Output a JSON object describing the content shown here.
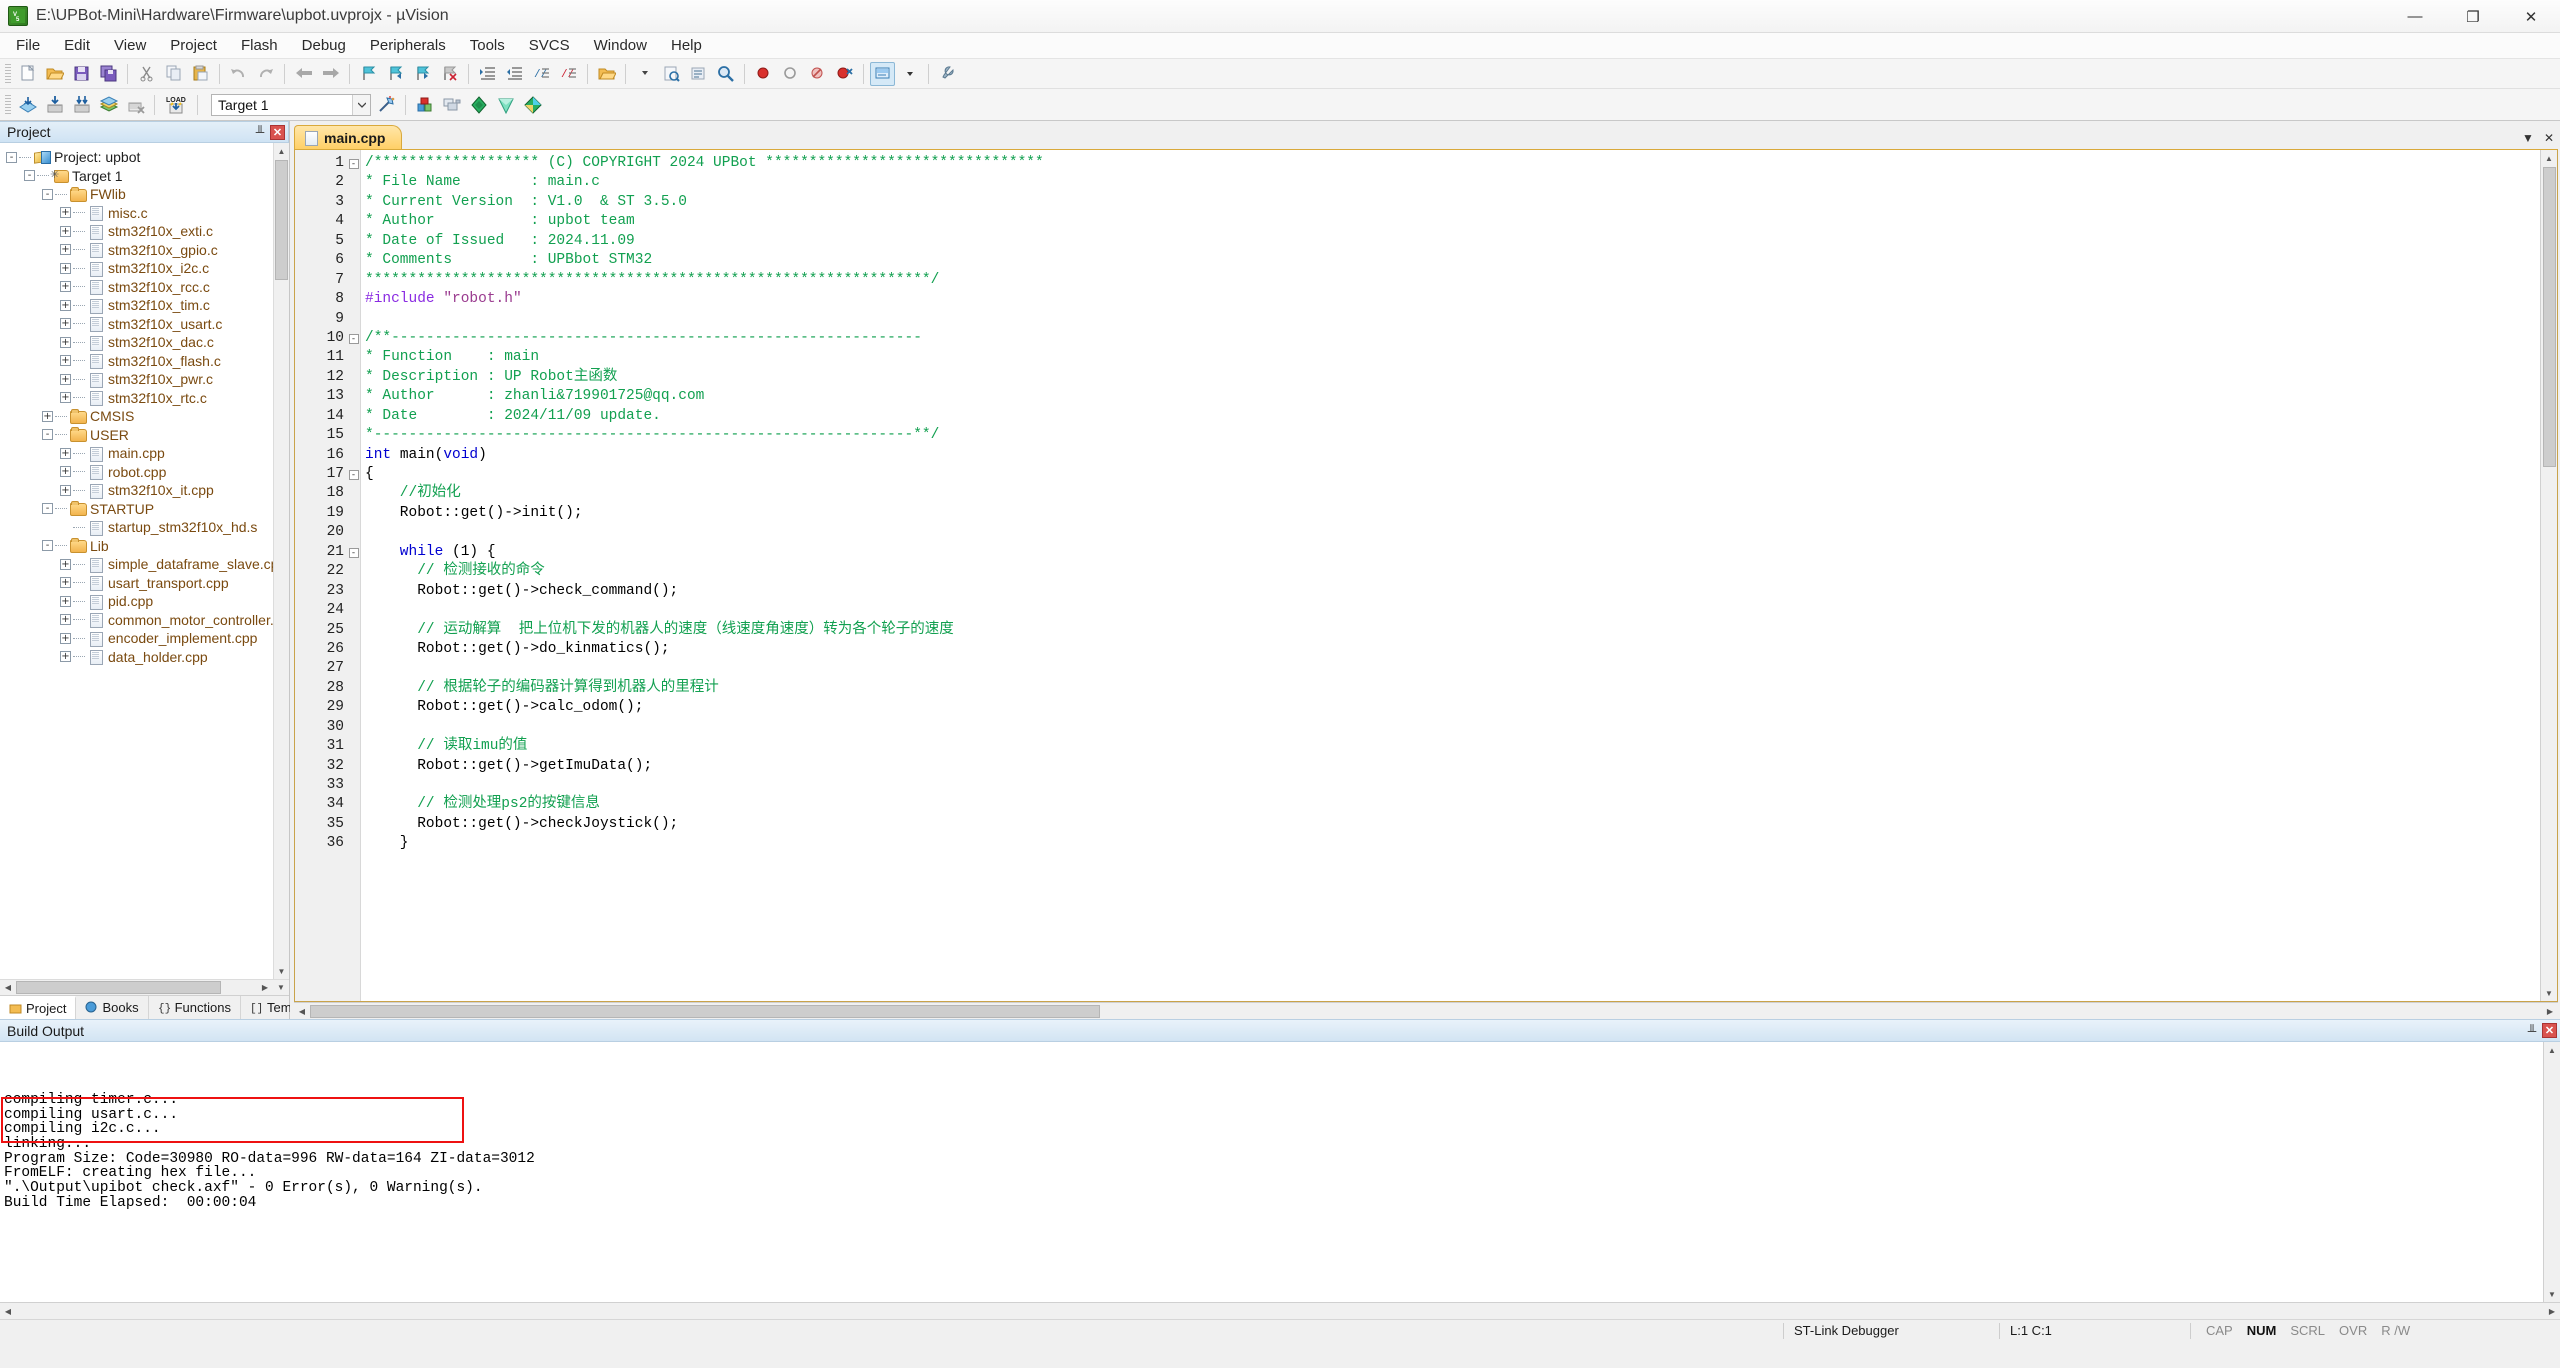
{
  "window": {
    "title": "E:\\UPBot-Mini\\Hardware\\Firmware\\upbot.uvprojx - µVision",
    "app_icon": "uvision-icon",
    "minimize": "—",
    "maximize": "❐",
    "close": "✕"
  },
  "menu": [
    "File",
    "Edit",
    "View",
    "Project",
    "Flash",
    "Debug",
    "Peripherals",
    "Tools",
    "SVCS",
    "Window",
    "Help"
  ],
  "toolbar_main": [
    "new-file-icon",
    "open-file-icon",
    "save-icon",
    "save-all-icon",
    "cut-icon",
    "copy-icon",
    "paste-icon",
    "undo-icon",
    "redo-icon",
    "navigate-back-icon",
    "navigate-forward-icon",
    "bookmark-toggle-icon",
    "bookmark-prev-icon",
    "bookmark-next-icon",
    "bookmark-clear-icon",
    "indent-icon",
    "outdent-icon",
    "comment-icon",
    "uncomment-icon",
    "open-folder-icon",
    "incremental-find-dropdown-icon",
    "find-in-files-icon",
    "browse-icon",
    "find-icon",
    "insert-breakpoint-icon",
    "remove-breakpoint-icon",
    "disable-breakpoint-icon",
    "kill-breakpoints-icon",
    "debug-session-icon",
    "configure-icon"
  ],
  "toolbar_build": [
    "translate-icon",
    "build-icon",
    "rebuild-icon",
    "batch-build-icon",
    "stop-build-icon",
    "download-icon"
  ],
  "target": {
    "selected": "Target 1",
    "dropdown_arrow": "chevron-down-icon",
    "buttons": [
      "target-options-icon",
      "manage-project-items-icon",
      "manage-run-time-env-icon",
      "pack-installer-icon",
      "manage-multi-project-icon",
      "select-software-packs-icon"
    ]
  },
  "project_panel": {
    "title": "Project",
    "pin_icon": "pin-icon",
    "close_icon": "close-icon",
    "tree": [
      {
        "label": "Project: upbot",
        "indent": 0,
        "toggle": "-",
        "icon": "proj"
      },
      {
        "label": "Target 1",
        "indent": 1,
        "toggle": "-",
        "icon": "target"
      },
      {
        "label": "FWlib",
        "indent": 2,
        "toggle": "-",
        "icon": "folder"
      },
      {
        "label": "misc.c",
        "indent": 3,
        "toggle": "+",
        "icon": "file"
      },
      {
        "label": "stm32f10x_exti.c",
        "indent": 3,
        "toggle": "+",
        "icon": "file"
      },
      {
        "label": "stm32f10x_gpio.c",
        "indent": 3,
        "toggle": "+",
        "icon": "file"
      },
      {
        "label": "stm32f10x_i2c.c",
        "indent": 3,
        "toggle": "+",
        "icon": "file"
      },
      {
        "label": "stm32f10x_rcc.c",
        "indent": 3,
        "toggle": "+",
        "icon": "file"
      },
      {
        "label": "stm32f10x_tim.c",
        "indent": 3,
        "toggle": "+",
        "icon": "file"
      },
      {
        "label": "stm32f10x_usart.c",
        "indent": 3,
        "toggle": "+",
        "icon": "file"
      },
      {
        "label": "stm32f10x_dac.c",
        "indent": 3,
        "toggle": "+",
        "icon": "file"
      },
      {
        "label": "stm32f10x_flash.c",
        "indent": 3,
        "toggle": "+",
        "icon": "file"
      },
      {
        "label": "stm32f10x_pwr.c",
        "indent": 3,
        "toggle": "+",
        "icon": "file"
      },
      {
        "label": "stm32f10x_rtc.c",
        "indent": 3,
        "toggle": "+",
        "icon": "file"
      },
      {
        "label": "CMSIS",
        "indent": 2,
        "toggle": "+",
        "icon": "folder"
      },
      {
        "label": "USER",
        "indent": 2,
        "toggle": "-",
        "icon": "folder"
      },
      {
        "label": "main.cpp",
        "indent": 3,
        "toggle": "+",
        "icon": "file"
      },
      {
        "label": "robot.cpp",
        "indent": 3,
        "toggle": "+",
        "icon": "file"
      },
      {
        "label": "stm32f10x_it.cpp",
        "indent": 3,
        "toggle": "+",
        "icon": "file"
      },
      {
        "label": "STARTUP",
        "indent": 2,
        "toggle": "-",
        "icon": "folder"
      },
      {
        "label": "startup_stm32f10x_hd.s",
        "indent": 3,
        "toggle": "",
        "icon": "file"
      },
      {
        "label": "Lib",
        "indent": 2,
        "toggle": "-",
        "icon": "folder"
      },
      {
        "label": "simple_dataframe_slave.cpp",
        "indent": 3,
        "toggle": "+",
        "icon": "file"
      },
      {
        "label": "usart_transport.cpp",
        "indent": 3,
        "toggle": "+",
        "icon": "file"
      },
      {
        "label": "pid.cpp",
        "indent": 3,
        "toggle": "+",
        "icon": "file"
      },
      {
        "label": "common_motor_controller.cpp",
        "indent": 3,
        "toggle": "+",
        "icon": "file"
      },
      {
        "label": "encoder_implement.cpp",
        "indent": 3,
        "toggle": "+",
        "icon": "file"
      },
      {
        "label": "data_holder.cpp",
        "indent": 3,
        "toggle": "+",
        "icon": "file"
      }
    ],
    "tabs": [
      {
        "label": "Project",
        "icon": "project-icon",
        "active": true
      },
      {
        "label": "Books",
        "icon": "books-icon",
        "active": false
      },
      {
        "label": "Functions",
        "icon": "functions-icon",
        "active": false
      },
      {
        "label": "Templates",
        "icon": "templates-icon",
        "active": false
      }
    ]
  },
  "editor": {
    "tab": {
      "label": "main.cpp",
      "icon": "file-icon"
    },
    "restore_icon": "chevron-down-icon",
    "close_icon": "close-icon",
    "lines": [
      {
        "n": 1,
        "fold": "-",
        "tokens": [
          {
            "t": "/******************* ",
            "c": "cmt"
          },
          {
            "t": "(C) COPYRIGHT 2024 UPBot ********************************",
            "c": "cmt"
          }
        ]
      },
      {
        "n": 2,
        "fold": "",
        "tokens": [
          {
            "t": "* File Name        : main.c",
            "c": "cmt"
          }
        ]
      },
      {
        "n": 3,
        "fold": "",
        "tokens": [
          {
            "t": "* Current Version  : V1.0  & ST 3.5.0",
            "c": "cmt"
          }
        ]
      },
      {
        "n": 4,
        "fold": "",
        "tokens": [
          {
            "t": "* Author           : upbot team",
            "c": "cmt"
          }
        ]
      },
      {
        "n": 5,
        "fold": "",
        "tokens": [
          {
            "t": "* Date of Issued   : 2024.11.09",
            "c": "cmt"
          }
        ]
      },
      {
        "n": 6,
        "fold": "",
        "tokens": [
          {
            "t": "* Comments         : UPBbot STM32",
            "c": "cmt"
          }
        ]
      },
      {
        "n": 7,
        "fold": "",
        "tokens": [
          {
            "t": "*****************************************************************/",
            "c": "cmt"
          }
        ]
      },
      {
        "n": 8,
        "fold": "",
        "tokens": [
          {
            "t": "#include ",
            "c": "pre"
          },
          {
            "t": "\"robot.h\"",
            "c": "str"
          }
        ]
      },
      {
        "n": 9,
        "fold": "",
        "tokens": []
      },
      {
        "n": 10,
        "fold": "-",
        "tokens": [
          {
            "t": "/**-------------------------------------------------------------",
            "c": "cmt"
          }
        ]
      },
      {
        "n": 11,
        "fold": "",
        "tokens": [
          {
            "t": "* Function    : main",
            "c": "cmt"
          }
        ]
      },
      {
        "n": 12,
        "fold": "",
        "tokens": [
          {
            "t": "* Description : UP Robot主函数",
            "c": "cmt"
          }
        ]
      },
      {
        "n": 13,
        "fold": "",
        "tokens": [
          {
            "t": "* Author      : zhanli&719901725@qq.com",
            "c": "cmt"
          }
        ]
      },
      {
        "n": 14,
        "fold": "",
        "tokens": [
          {
            "t": "* Date        : 2024/11/09 update.",
            "c": "cmt"
          }
        ]
      },
      {
        "n": 15,
        "fold": "",
        "tokens": [
          {
            "t": "*--------------------------------------------------------------**/",
            "c": "cmt"
          }
        ]
      },
      {
        "n": 16,
        "fold": "",
        "tokens": [
          {
            "t": "int ",
            "c": "kw"
          },
          {
            "t": "main(",
            "c": "plain"
          },
          {
            "t": "void",
            "c": "kw"
          },
          {
            "t": ")",
            "c": "plain"
          }
        ]
      },
      {
        "n": 17,
        "fold": "-",
        "tokens": [
          {
            "t": "{",
            "c": "plain"
          }
        ]
      },
      {
        "n": 18,
        "fold": "",
        "tokens": [
          {
            "t": "    //初始化",
            "c": "cmt"
          }
        ]
      },
      {
        "n": 19,
        "fold": "",
        "tokens": [
          {
            "t": "    Robot::get()->init();",
            "c": "plain"
          }
        ]
      },
      {
        "n": 20,
        "fold": "",
        "tokens": []
      },
      {
        "n": 21,
        "fold": "-",
        "tokens": [
          {
            "t": "    while ",
            "c": "kw"
          },
          {
            "t": "(1) {",
            "c": "plain"
          }
        ]
      },
      {
        "n": 22,
        "fold": "",
        "tokens": [
          {
            "t": "      // 检测接收的命令",
            "c": "cmt"
          }
        ]
      },
      {
        "n": 23,
        "fold": "",
        "tokens": [
          {
            "t": "      Robot::get()->check_command();",
            "c": "plain"
          }
        ]
      },
      {
        "n": 24,
        "fold": "",
        "tokens": []
      },
      {
        "n": 25,
        "fold": "",
        "tokens": [
          {
            "t": "      // 运动解算  把上位机下发的机器人的速度（线速度角速度）转为各个轮子的速度",
            "c": "cmt"
          }
        ]
      },
      {
        "n": 26,
        "fold": "",
        "tokens": [
          {
            "t": "      Robot::get()->do_kinmatics();",
            "c": "plain"
          }
        ]
      },
      {
        "n": 27,
        "fold": "",
        "tokens": []
      },
      {
        "n": 28,
        "fold": "",
        "tokens": [
          {
            "t": "      // 根据轮子的编码器计算得到机器人的里程计",
            "c": "cmt"
          }
        ]
      },
      {
        "n": 29,
        "fold": "",
        "tokens": [
          {
            "t": "      Robot::get()->calc_odom();",
            "c": "plain"
          }
        ]
      },
      {
        "n": 30,
        "fold": "",
        "tokens": []
      },
      {
        "n": 31,
        "fold": "",
        "tokens": [
          {
            "t": "      // 读取imu的值",
            "c": "cmt"
          }
        ]
      },
      {
        "n": 32,
        "fold": "",
        "tokens": [
          {
            "t": "      Robot::get()->getImuData();",
            "c": "plain"
          }
        ]
      },
      {
        "n": 33,
        "fold": "",
        "tokens": []
      },
      {
        "n": 34,
        "fold": "",
        "tokens": [
          {
            "t": "      // 检测处理ps2的按键信息",
            "c": "cmt"
          }
        ]
      },
      {
        "n": 35,
        "fold": "",
        "tokens": [
          {
            "t": "      Robot::get()->checkJoystick();",
            "c": "plain"
          }
        ]
      },
      {
        "n": 36,
        "fold": "",
        "tokens": [
          {
            "t": "    }",
            "c": "plain"
          }
        ]
      }
    ]
  },
  "build_output": {
    "title": "Build Output",
    "pin_icon": "pin-icon",
    "close_icon": "close-icon",
    "lines": [
      "compiling timer.c...",
      "compiling usart.c...",
      "compiling i2c.c...",
      "linking...",
      "Program Size: Code=30980 RO-data=996 RW-data=164 ZI-data=3012",
      "FromELF: creating hex file...",
      "\".\\Output\\upibot check.axf\" - 0 Error(s), 0 Warning(s).",
      "Build Time Elapsed:  00:00:04"
    ],
    "highlight_color": "#ee1111",
    "highlight_from": 4,
    "highlight_to": 6
  },
  "statusbar": {
    "debugger": "ST-Link Debugger",
    "position": "L:1 C:1",
    "flags": [
      {
        "label": "CAP",
        "on": false
      },
      {
        "label": "NUM",
        "on": true
      },
      {
        "label": "SCRL",
        "on": false
      },
      {
        "label": "OVR",
        "on": false
      },
      {
        "label": "R /W",
        "on": false
      }
    ]
  }
}
